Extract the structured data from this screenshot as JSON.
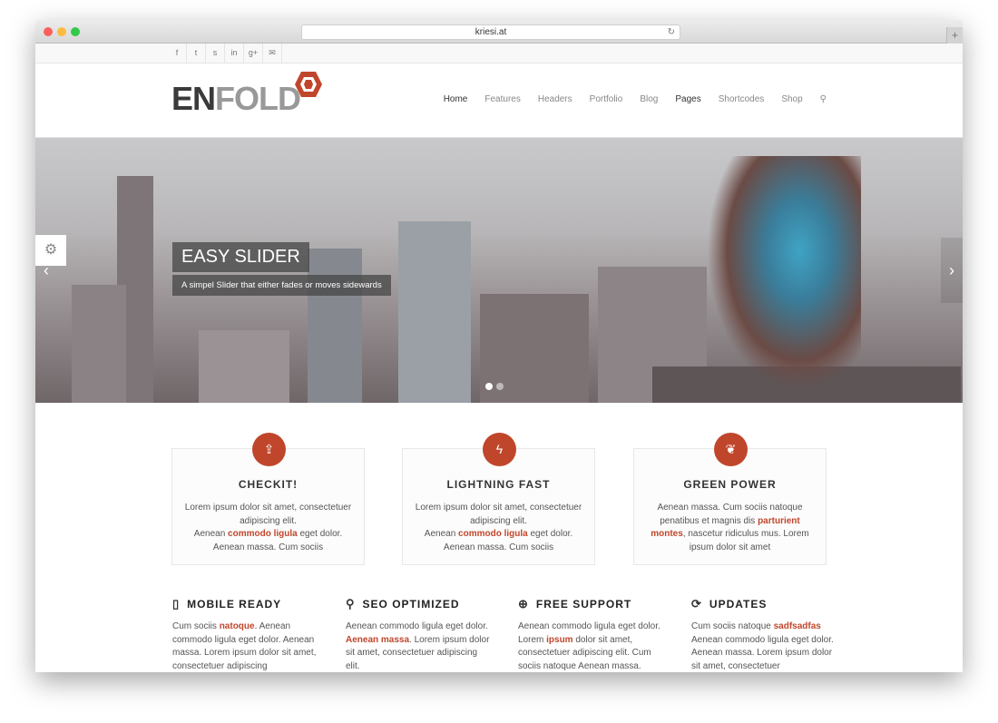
{
  "browser": {
    "url": "kriesi.at",
    "reload_icon": "reload-icon",
    "new_tab": "+"
  },
  "social": [
    "f",
    "t",
    "s",
    "in",
    "g+",
    "✉"
  ],
  "logo": {
    "en": "EN",
    "fold": "FOLD"
  },
  "nav": [
    "Home",
    "Features",
    "Headers",
    "Portfolio",
    "Blog",
    "Pages",
    "Shortcodes",
    "Shop"
  ],
  "slider": {
    "title": "EASY SLIDER",
    "subtitle": "A simpel Slider that either fades or moves sidewards",
    "slides": 2,
    "active": 1
  },
  "colors": {
    "accent": "#c0462b"
  },
  "boxes": [
    {
      "title": "CHECKIT!",
      "icon": "share-icon",
      "p": [
        {
          "t": "Lorem ipsum dolor sit amet, consectetuer adipiscing elit. "
        },
        {
          "t": "Aenean "
        },
        {
          "t": "commodo ligula",
          "hl": true
        },
        {
          "t": " eget dolor. Aenean massa. Cum sociis"
        }
      ]
    },
    {
      "title": "LIGHTNING FAST",
      "icon": "lightning-icon",
      "p": [
        {
          "t": "Lorem ipsum dolor sit amet, consectetuer adipiscing elit. "
        },
        {
          "t": "Aenean "
        },
        {
          "t": "commodo ligula",
          "hl": true
        },
        {
          "t": " eget dolor. Aenean massa. Cum sociis"
        }
      ]
    },
    {
      "title": "GREEN POWER",
      "icon": "leaf-icon",
      "p": [
        {
          "t": "Aenean massa. Cum sociis natoque penatibus et magnis dis "
        },
        {
          "t": "parturient montes",
          "hl": true
        },
        {
          "t": ", nascetur ridiculus mus. Lorem ipsum dolor sit amet"
        },
        {
          "t": ""
        }
      ]
    }
  ],
  "features": [
    {
      "title": "MOBILE READY",
      "icon": "mobile-icon",
      "p": [
        {
          "t": "Cum sociis "
        },
        {
          "t": "natoque",
          "hl": true
        },
        {
          "t": ". Aenean commodo ligula eget dolor. Aenean massa. Lorem ipsum dolor sit amet, consectetuer adipiscing"
        }
      ]
    },
    {
      "title": "SEO OPTIMIZED",
      "icon": "search-icon",
      "p": [
        {
          "t": "Aenean commodo ligula eget dolor. "
        },
        {
          "t": "Aenean massa",
          "hl": true
        },
        {
          "t": ". Lorem ipsum dolor sit amet, consectetuer adipiscing elit."
        }
      ]
    },
    {
      "title": "FREE SUPPORT",
      "icon": "lifebuoy-icon",
      "p": [
        {
          "t": "Aenean commodo ligula eget dolor. Lorem "
        },
        {
          "t": "ipsum",
          "hl": true
        },
        {
          "t": " dolor sit amet, consectetuer adipiscing elit. Cum sociis natoque Aenean massa."
        }
      ]
    },
    {
      "title": "UPDATES",
      "icon": "refresh-icon",
      "p": [
        {
          "t": "Cum sociis natoque "
        },
        {
          "t": "sadfsadfas",
          "hl": true
        },
        {
          "t": " Aenean commodo ligula eget dolor. Aenean massa. Lorem ipsum dolor sit amet, consectetuer"
        }
      ]
    }
  ]
}
